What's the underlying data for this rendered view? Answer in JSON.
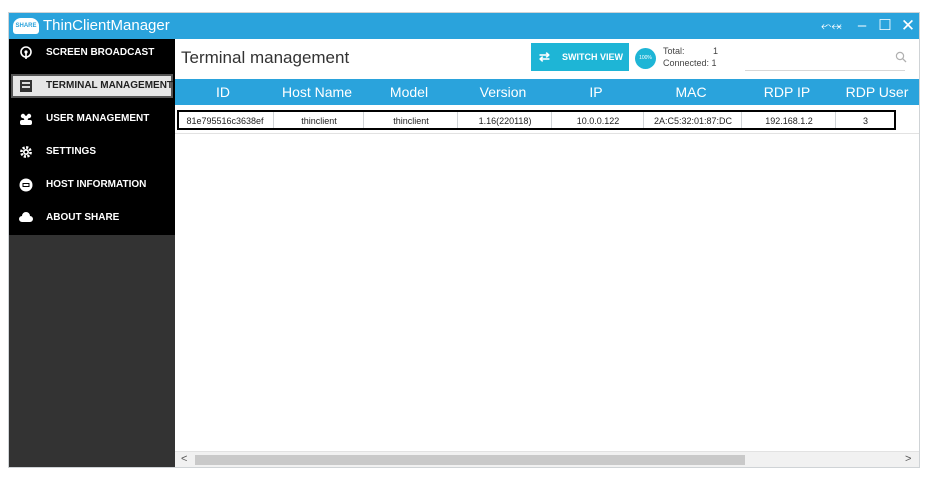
{
  "app": {
    "title": "ThinClientManager",
    "logo_text": "SHARE"
  },
  "window_controls": {
    "tray": "⬿⬾",
    "minimize": "–",
    "maximize": "☐",
    "close": "✕"
  },
  "sidebar": {
    "items": [
      {
        "label": "SCREEN BROADCAST",
        "icon": "broadcast-icon"
      },
      {
        "label": "TERMINAL MANAGEMENT",
        "icon": "terminal-icon",
        "active": true
      },
      {
        "label": "USER MANAGEMENT",
        "icon": "users-icon"
      },
      {
        "label": "SETTINGS",
        "icon": "gear-icon"
      },
      {
        "label": "HOST INFORMATION",
        "icon": "host-icon"
      },
      {
        "label": "ABOUT SHARE",
        "icon": "cloud-icon"
      }
    ]
  },
  "main": {
    "title": "Terminal management",
    "switch_view": "SWITCH VIEW",
    "status_circle": "100%",
    "total_label": "Total:",
    "total_value": "1",
    "connected_label": "Connected: 1",
    "search_icon": "search-icon"
  },
  "table": {
    "columns": [
      "ID",
      "Host Name",
      "Model",
      "Version",
      "IP",
      "MAC",
      "RDP IP",
      "RDP User"
    ],
    "rows": [
      [
        "81e795516c3638ef",
        "thinclient",
        "thinclient",
        "1.16(220118)",
        "10.0.0.122",
        "2A:C5:32:01:87:DC",
        "192.168.1.2",
        "3"
      ]
    ]
  },
  "scrollbar": {
    "left": "<",
    "right": ">"
  },
  "colors": {
    "accent": "#2aa3dc",
    "button": "#1eb5d6",
    "sidebar": "#000000",
    "sidebar_lower": "#333333"
  }
}
